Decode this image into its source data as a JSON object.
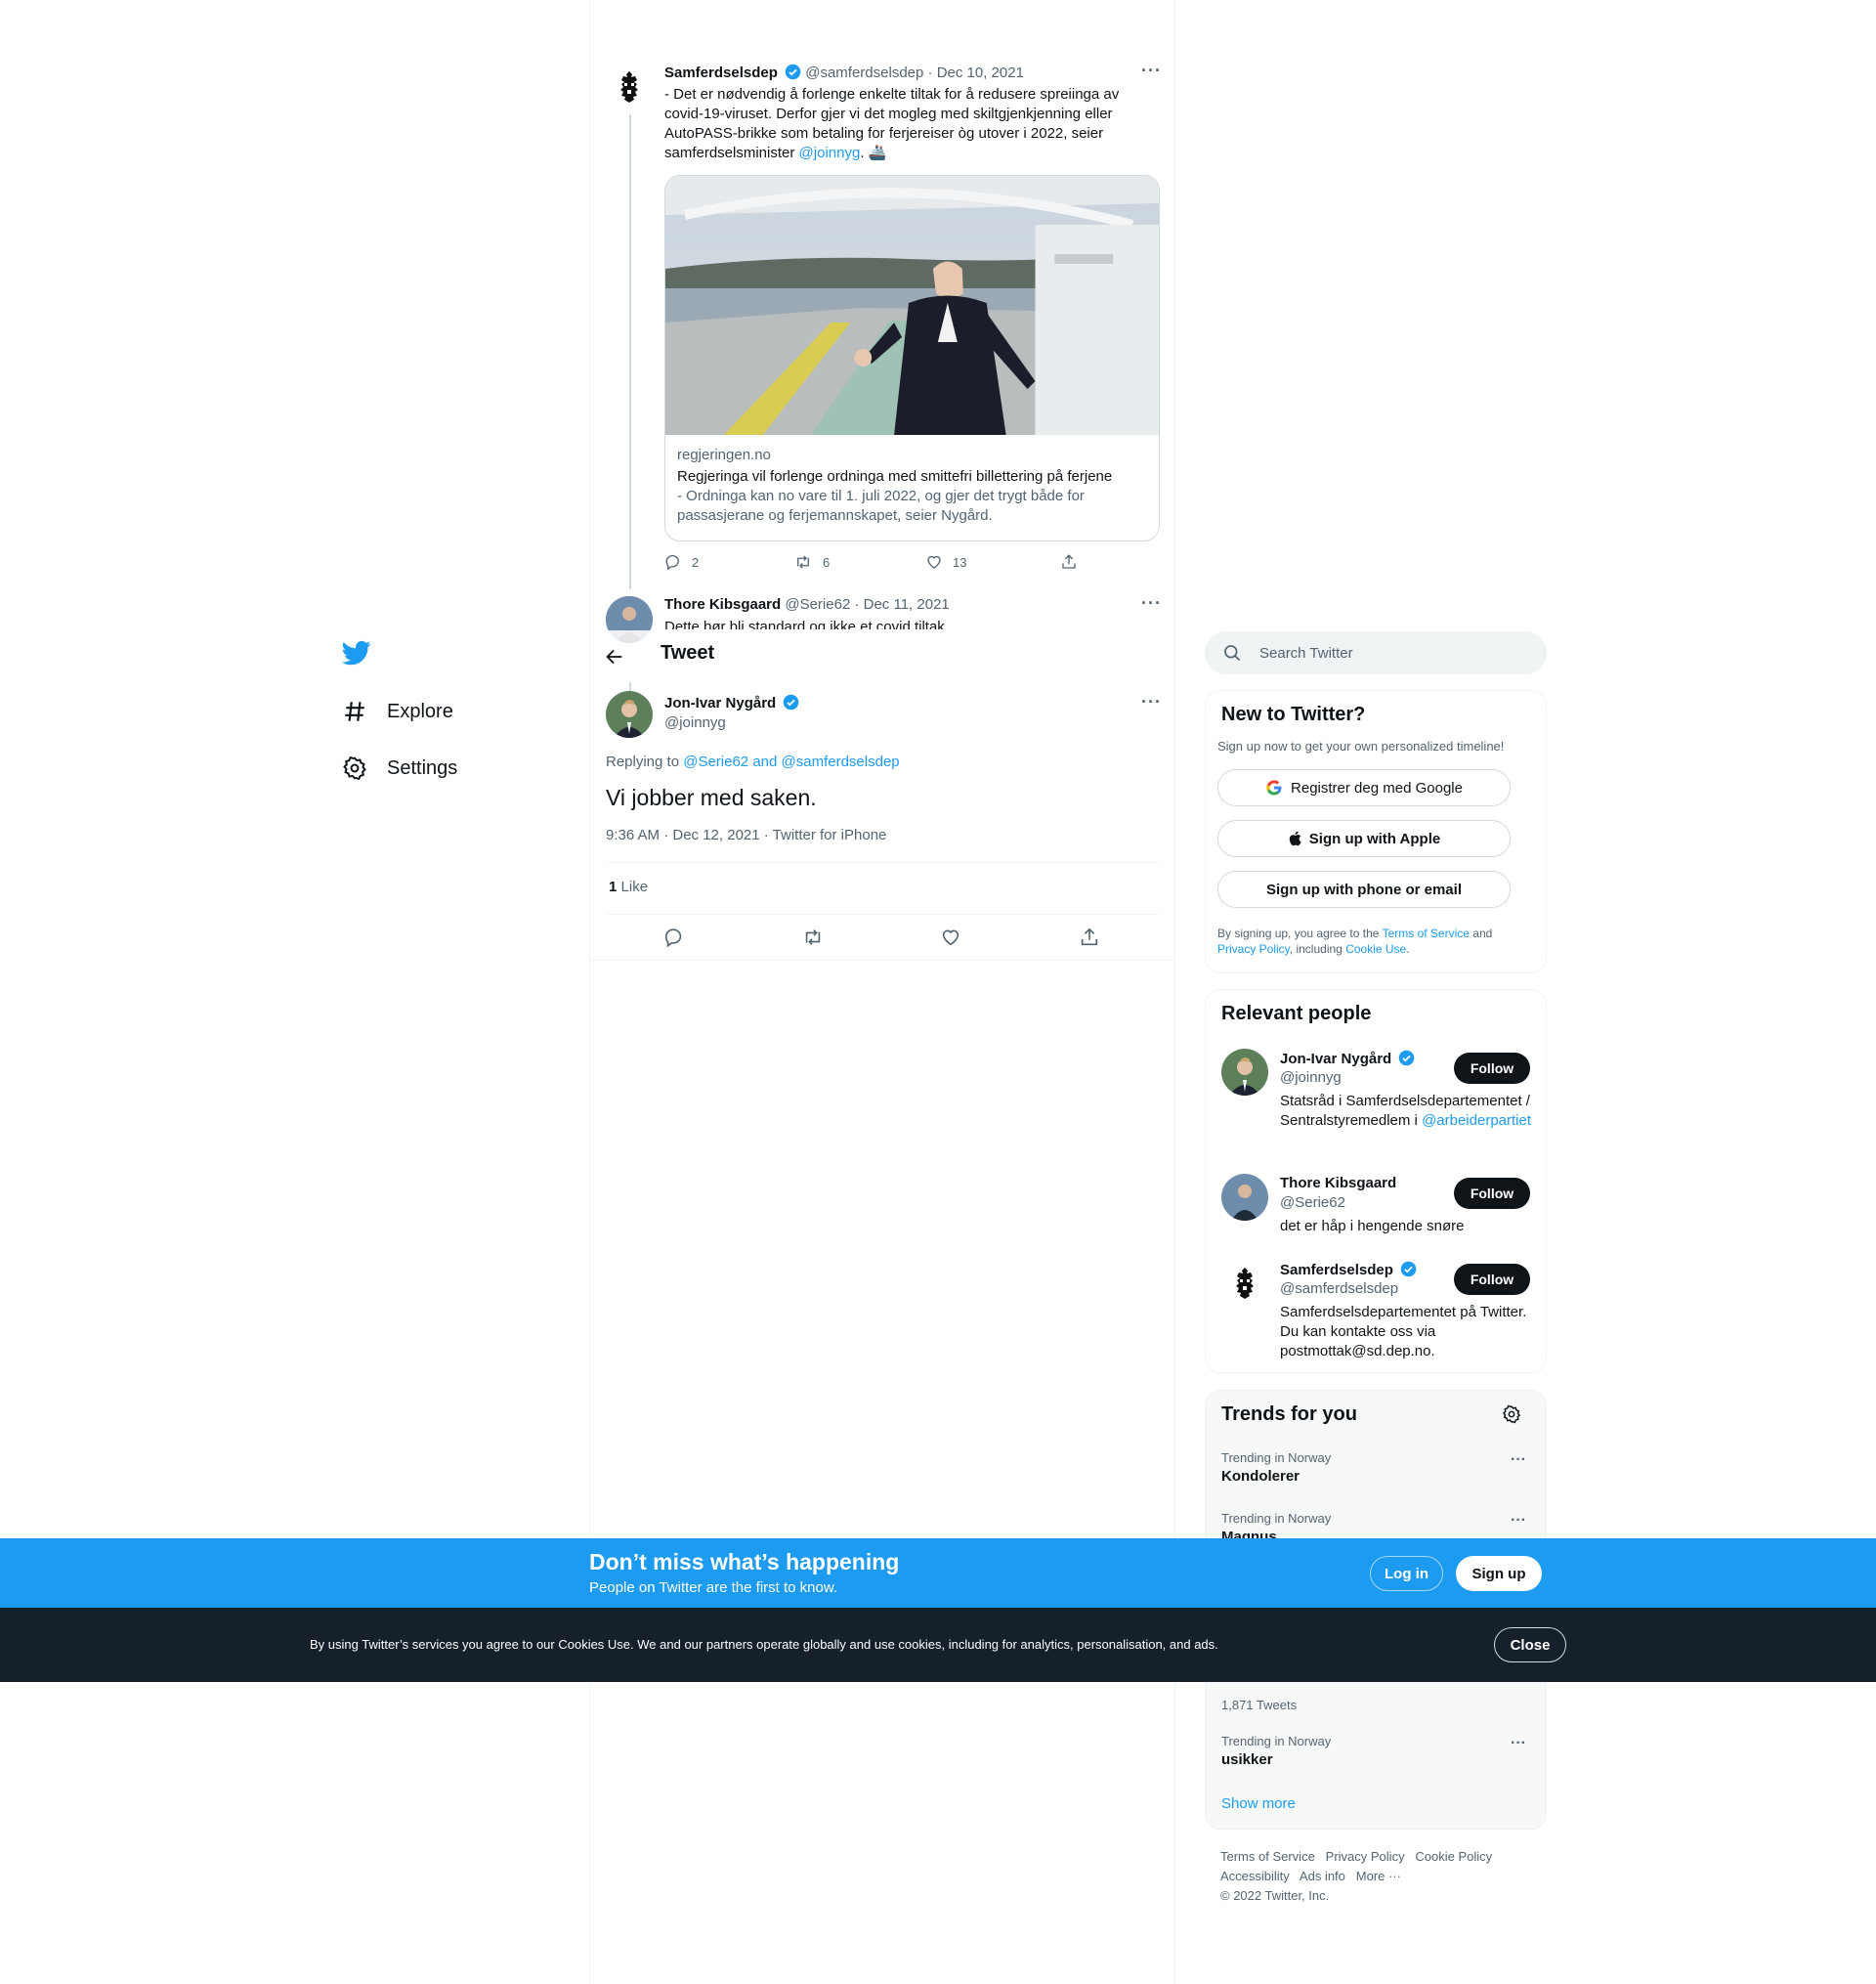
{
  "nav": {
    "explore": "Explore",
    "settings": "Settings"
  },
  "header": {
    "title": "Tweet"
  },
  "quoted_tweet": {
    "name": "Samferdselsdep",
    "handle": "@samferdselsdep",
    "date": "· Dec 10, 2021",
    "text_before_mention": "- Det er nødvendig å forlenge enkelte tiltak for å redusere spreiinga av covid-19-viruset. Derfor gjer vi det mogleg med skiltgjenkjenning eller AutoPASS-brikke som betaling for ferjereiser òg utover i 2022, seier samferdselsminister",
    "mention": "@joinnyg",
    "text_after_mention": ". 🚢",
    "card": {
      "domain": "regjeringen.no",
      "title": "Regjeringa vil forlenge ordninga med smittefri billettering på ferjene",
      "description": "- Ordninga kan no vare til 1. juli 2022, og gjer det trygt både for passasjerane og ferjemannskapet, seier Nygård."
    },
    "replies": "2",
    "retweets": "6",
    "likes": "13"
  },
  "reply_tweet": {
    "name": "Thore Kibsgaard",
    "handle": "@Serie62",
    "date": "· Dec 11, 2021",
    "text": "Dette bør bli standard og ikke et covid tiltak"
  },
  "main_tweet": {
    "name": "Jon-Ivar Nygård",
    "handle": "@joinnyg",
    "replying_prefix": "Replying to",
    "replying_users": "@Serie62 and @samferdselsdep",
    "text": "Vi jobber med saken.",
    "meta": "9:36 AM · Dec 12, 2021 · Twitter for iPhone",
    "like_count": "1",
    "like_label": "Like"
  },
  "sidebar": {
    "search_placeholder": "Search Twitter",
    "new_to_twitter": {
      "title": "New to Twitter?",
      "subtitle": "Sign up now to get your own personalized timeline!",
      "google": "Registrer deg med Google",
      "apple": "Sign up with Apple",
      "phone": "Sign up with phone or email",
      "legal_1": "By signing up, you agree to the",
      "terms": "Terms of Service",
      "legal_and": "and",
      "privacy": "Privacy Policy",
      "legal_including": ", including",
      "cookie": "Cookie Use",
      "legal_end": "."
    },
    "relevant_people": {
      "title": "Relevant people",
      "people": [
        {
          "name": "Jon-Ivar Nygård",
          "handle": "@joinnyg",
          "bio": "Statsråd i Samferdselsdepartementet / Sentralstyremedlem i",
          "bio_link": "@arbeiderpartiet",
          "follow": "Follow"
        },
        {
          "name": "Thore Kibsgaard",
          "handle": "@Serie62",
          "bio": "det er håp i hengende snøre",
          "follow": "Follow"
        },
        {
          "name": "Samferdselsdep",
          "handle": "@samferdselsdep",
          "bio": "Samferdselsdepartementet på Twitter. Du kan kontakte oss via postmottak@sd.dep.no.",
          "follow": "Follow"
        }
      ]
    },
    "trends": {
      "title": "Trends for you",
      "items": [
        {
          "context": "Trending in Norway",
          "name": "Kondolerer"
        },
        {
          "context": "Trending in Norway",
          "name": "Magnus"
        },
        {
          "context": "",
          "name": "",
          "count": "1,871 Tweets"
        },
        {
          "context": "Trending in Norway",
          "name": "usikker"
        }
      ],
      "show_more": "Show more"
    },
    "footer": {
      "terms": "Terms of Service",
      "privacy": "Privacy Policy",
      "cookie": "Cookie Policy",
      "accessibility": "Accessibility",
      "ads": "Ads info",
      "more": "More ···",
      "copyright": "© 2022 Twitter, Inc."
    }
  },
  "banner": {
    "title": "Don’t miss what’s happening",
    "subtitle": "People on Twitter are the first to know.",
    "login": "Log in",
    "signup": "Sign up"
  },
  "cookie_banner": {
    "text": "By using Twitter’s services you agree to our Cookies Use. We and our partners operate globally and use cookies, including for analytics, personalisation, and ads.",
    "close": "Close"
  },
  "colors": {
    "accent": "#1d9bf0",
    "text": "#0f1419",
    "muted": "#536471",
    "border": "#eff3f4",
    "dark_banner": "#15202b"
  }
}
